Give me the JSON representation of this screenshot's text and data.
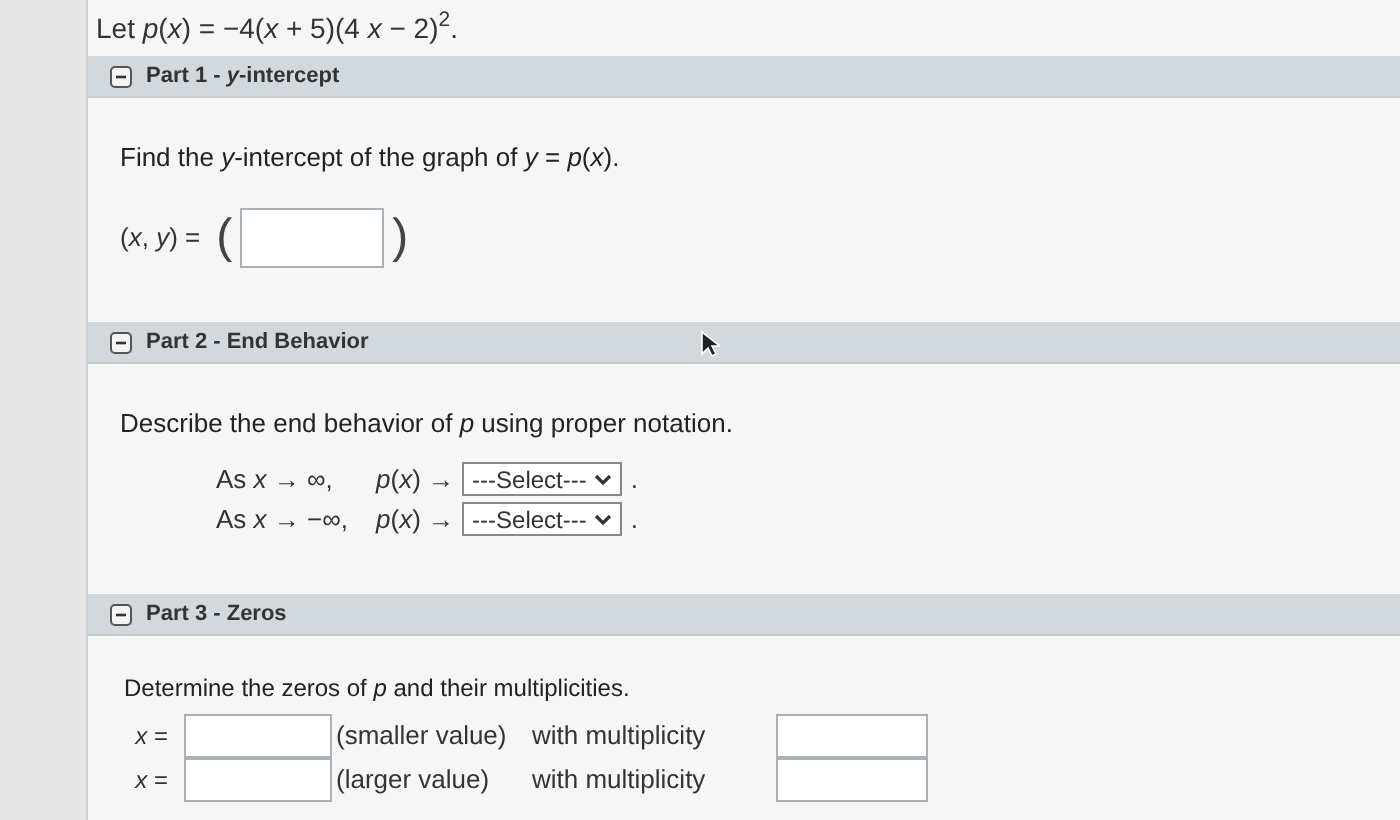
{
  "intro": "Let *p*(*x*) = −4(*x* + 5)(4 *x* − 2)$^{2}$.",
  "parts": [
    {
      "title": "Part 1 - *y*-intercept",
      "expanded": true,
      "kind": "point",
      "prompt": "Find the *y*-intercept of the graph of *y* = *p*(*x*).",
      "label": "(*x*, *y*) =",
      "open": "(",
      "close": ")"
    },
    {
      "title": "Part 2 - End Behavior",
      "expanded": true,
      "kind": "limits",
      "prompt": "Describe the end behavior of *p* using proper notation.",
      "rows": [
        {
          "left": "As *x* → ∞,",
          "right": "*p*(*x*) →",
          "select": "---Select---",
          "end": "."
        },
        {
          "left": "As *x* → −∞,",
          "right": "*p*(*x*) →",
          "select": "---Select---",
          "end": "."
        }
      ]
    },
    {
      "title": "Part 3 - Zeros",
      "expanded": true,
      "kind": "zeros",
      "prompt": "Determine the zeros of *p* and their multiplicities.",
      "rows": [
        {
          "label": "*x* =",
          "note": "(smaller value)",
          "mult": "with multiplicity"
        },
        {
          "label": "*x* =",
          "note": "(larger value)",
          "mult": "with multiplicity"
        }
      ]
    }
  ]
}
